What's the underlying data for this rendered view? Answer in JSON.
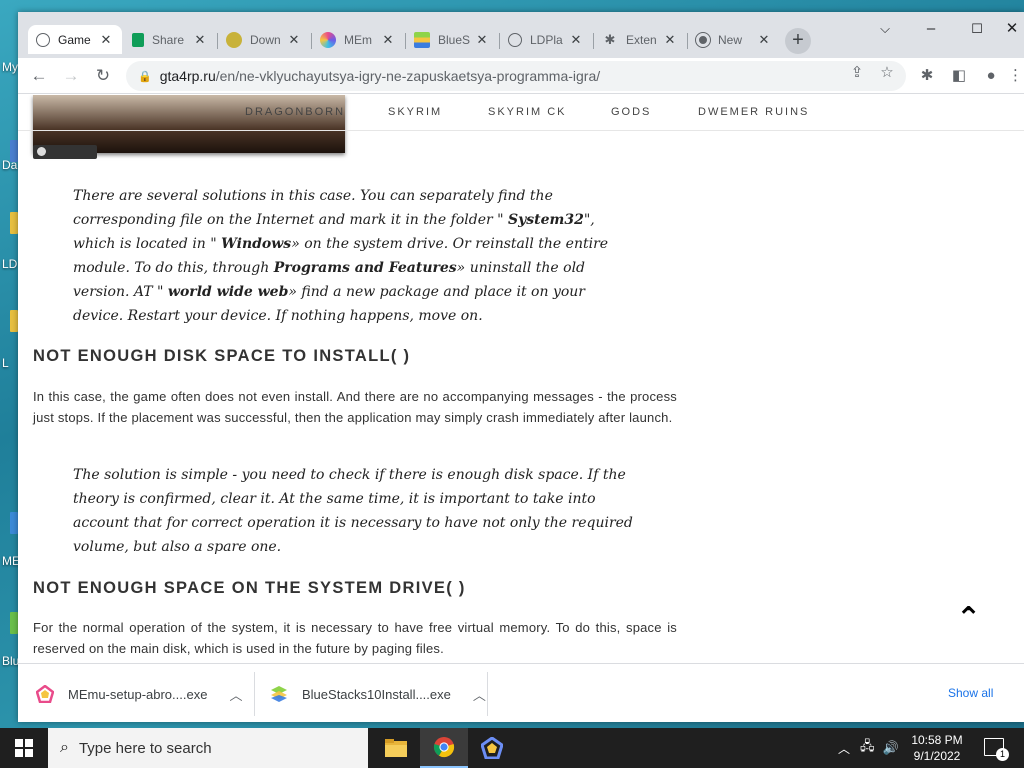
{
  "desktop": {
    "labels": [
      "My",
      "Da",
      "LD",
      "L",
      "ME",
      "Blu"
    ]
  },
  "browser": {
    "tabs": [
      {
        "label": "Game",
        "icon": "globe-icon",
        "active": true
      },
      {
        "label": "Share",
        "icon": "sheets-icon"
      },
      {
        "label": "Down",
        "icon": "android-icon"
      },
      {
        "label": "MEm",
        "icon": "memu-icon"
      },
      {
        "label": "BlueS",
        "icon": "bluestacks-icon"
      },
      {
        "label": "LDPla",
        "icon": "globe-icon"
      },
      {
        "label": "Exten",
        "icon": "puzzle-icon"
      },
      {
        "label": "New",
        "icon": "chrome-icon"
      }
    ],
    "address": {
      "host": "gta4rp.ru",
      "path": "/en/ne-vklyuchayutsya-igry-ne-zapuskaetsya-programma-igra/"
    }
  },
  "site": {
    "nav": [
      "DRAGONBORN",
      "SKYRIM",
      "SKYRIM CK",
      "GODS",
      "DWEMER RUINS"
    ],
    "quote1": [
      {
        "t": "There are several solutions in this case. You can separately find the corresponding file on the Internet and mark it in the folder \" "
      },
      {
        "t": "System32",
        "b": true
      },
      {
        "t": "\", which is located in \" "
      },
      {
        "t": "Windows",
        "b": true
      },
      {
        "t": "» on the system drive. Or reinstall the entire module. To do this, through "
      },
      {
        "t": "Programs and Features",
        "b": true
      },
      {
        "t": "» uninstall the old version. AT \" "
      },
      {
        "t": "world wide web",
        "b": true
      },
      {
        "t": "» find a new package and place it on your device. Restart your device. If nothing happens, move on."
      }
    ],
    "heading1": "NOT ENOUGH DISK SPACE TO INSTALL( )",
    "para1": "In this case, the game often does not even install. And there are no accompanying messages - the process just stops. If the placement was successful, then the application may simply crash immediately after launch.",
    "quote2": "The solution is simple - you need to check if there is enough disk space. If the theory is confirmed, clear it. At the same time, it is important to take into account that for correct operation it is necessary to have not only the required volume, but also a spare one.",
    "heading2": "NOT ENOUGH SPACE ON THE SYSTEM DRIVE( )",
    "para2": "For the normal operation of the system, it is necessary to have free virtual memory. To do this, space is reserved on the main disk, which is used in the future by paging files."
  },
  "downloads": {
    "items": [
      {
        "name": "MEmu-setup-abro....exe",
        "icon": "memu-icon"
      },
      {
        "name": "BlueStacks10Install....exe",
        "icon": "bluestacks-icon"
      }
    ],
    "show_all": "Show all"
  },
  "taskbar": {
    "search_placeholder": "Type here to search",
    "time": "10:58 PM",
    "date": "9/1/2022",
    "notifications": "1"
  }
}
